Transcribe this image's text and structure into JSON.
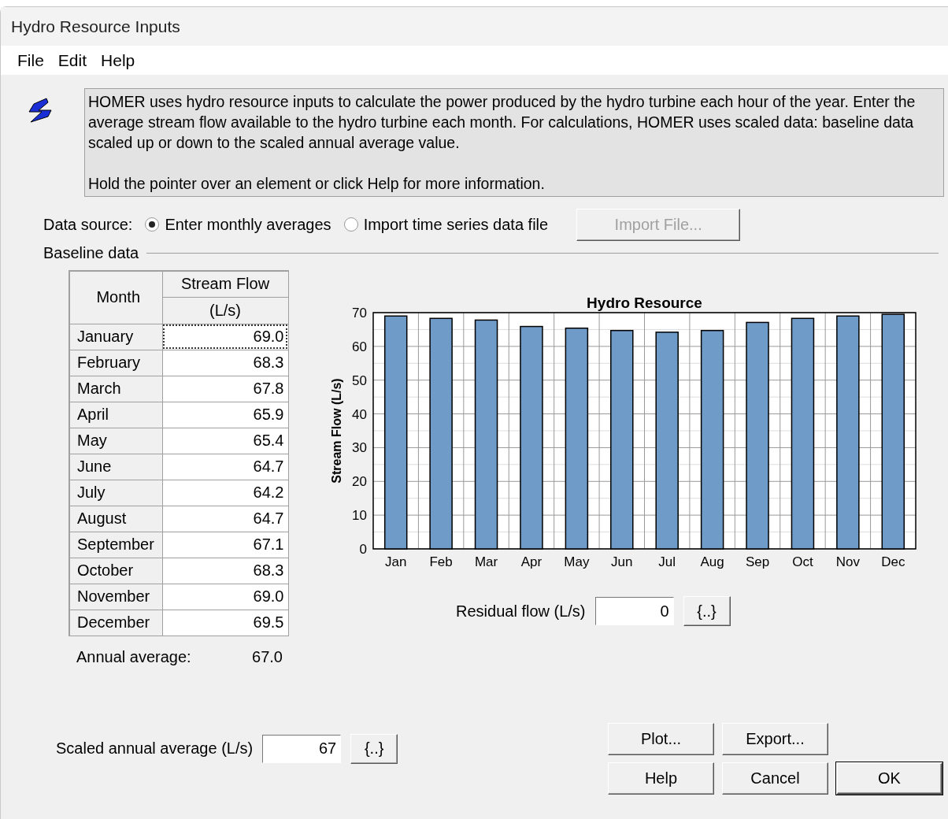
{
  "window": {
    "title": "Hydro Resource Inputs"
  },
  "menu": [
    "File",
    "Edit",
    "Help"
  ],
  "description": [
    "HOMER uses hydro resource inputs to calculate the power produced by the hydro turbine each hour of the year. Enter the average stream flow available to the hydro turbine each month. For calculations, HOMER uses scaled data: baseline data scaled up or down to the scaled annual average value.",
    "Hold the pointer over an element or click Help for more information."
  ],
  "data_source": {
    "label": "Data source:",
    "options": [
      {
        "label": "Enter monthly averages",
        "selected": true
      },
      {
        "label": "Import time series data file",
        "selected": false
      }
    ],
    "import_button": {
      "label": "Import File...",
      "disabled": true
    }
  },
  "baseline": {
    "title": "Baseline data",
    "table": {
      "columns": [
        {
          "label": "Month"
        },
        {
          "label": "Stream Flow",
          "unit": "(L/s)"
        }
      ],
      "rows": [
        {
          "month": "January",
          "value": "69.0",
          "selected": true
        },
        {
          "month": "February",
          "value": "68.3",
          "selected": false
        },
        {
          "month": "March",
          "value": "67.8",
          "selected": false
        },
        {
          "month": "April",
          "value": "65.9",
          "selected": false
        },
        {
          "month": "May",
          "value": "65.4",
          "selected": false
        },
        {
          "month": "June",
          "value": "64.7",
          "selected": false
        },
        {
          "month": "July",
          "value": "64.2",
          "selected": false
        },
        {
          "month": "August",
          "value": "64.7",
          "selected": false
        },
        {
          "month": "September",
          "value": "67.1",
          "selected": false
        },
        {
          "month": "October",
          "value": "68.3",
          "selected": false
        },
        {
          "month": "November",
          "value": "69.0",
          "selected": false
        },
        {
          "month": "December",
          "value": "69.5",
          "selected": false
        }
      ]
    },
    "annual_average": {
      "label": "Annual average:",
      "value": "67.0"
    },
    "chart": {
      "chart_data": {
        "type": "bar",
        "title": "Hydro Resource",
        "ylabel": "Stream Flow (L/s)",
        "categories": [
          "Jan",
          "Feb",
          "Mar",
          "Apr",
          "May",
          "Jun",
          "Jul",
          "Aug",
          "Sep",
          "Oct",
          "Nov",
          "Dec"
        ],
        "grid": true,
        "series": [
          {
            "color": "#6f9bc8",
            "values": [
              69.0,
              68.3,
              67.8,
              65.9,
              65.4,
              64.7,
              64.2,
              64.7,
              67.1,
              68.3,
              69.0,
              69.5
            ]
          }
        ],
        "ylim": [
          0,
          70
        ],
        "yticks": [
          0,
          10,
          20,
          30,
          40,
          50,
          60,
          70
        ]
      }
    },
    "residual": {
      "label": "Residual flow (L/s)",
      "value": "0",
      "button": "{..}"
    }
  },
  "scaled": {
    "label": "Scaled annual average (L/s)",
    "value": "67",
    "button": "{..}"
  },
  "buttons": [
    {
      "label": "Plot...",
      "default": false
    },
    {
      "label": "Export...",
      "default": false
    },
    {
      "label": "Help",
      "default": false
    },
    {
      "label": "Cancel",
      "default": false
    },
    {
      "label": "OK",
      "default": true
    }
  ]
}
